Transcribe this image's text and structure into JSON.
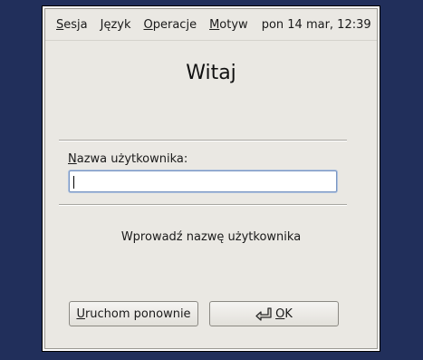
{
  "menubar": {
    "items": [
      {
        "label_first": "S",
        "label_rest": "esja"
      },
      {
        "label_first": "J",
        "label_rest": "ęzyk"
      },
      {
        "label_first": "O",
        "label_rest": "peracje"
      },
      {
        "label_first": "M",
        "label_rest": "otyw"
      }
    ],
    "clock": "pon 14 mar, 12:39"
  },
  "welcome_title": "Witaj",
  "username": {
    "label_first": "N",
    "label_rest": "azwa użytkownika:",
    "value": ""
  },
  "prompt": "Wprowadź nazwę użytkownika",
  "buttons": {
    "restart_first": "U",
    "restart_rest": "ruchom ponownie",
    "ok_first": "O",
    "ok_rest": "K",
    "ok_icon": "return-arrow-icon"
  },
  "colors": {
    "desktop": "#212f5b",
    "window_bg": "#eae8e3",
    "input_focus": "#7a96c2"
  }
}
